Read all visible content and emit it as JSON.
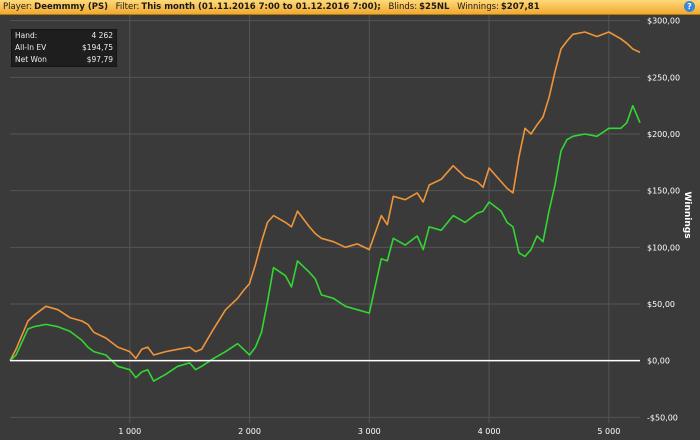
{
  "header": {
    "player_label": "Player:",
    "player_value": "Deemmmy (PS)",
    "filter_label": "Filter:",
    "filter_value": "This month (01.11.2016 7:00 to 01.12.2016 7:00);",
    "blinds_label": "Blinds:",
    "blinds_value": "$25NL",
    "winnings_label": "Winnings:",
    "winnings_value": "$207,81",
    "help_icon": "?"
  },
  "stats": [
    {
      "label": "Hand:",
      "value": "4 262"
    },
    {
      "label": "All-In EV",
      "value": "$194,75"
    },
    {
      "label": "Net Won",
      "value": "$97,79"
    }
  ],
  "chart_data": {
    "type": "line",
    "xlabel": "",
    "ylabel": "Winnings",
    "xlim": [
      0,
      5260
    ],
    "ylim": [
      -55,
      305
    ],
    "x_ticks": [
      1000,
      2000,
      3000,
      4000,
      5000
    ],
    "x_tick_labels": [
      "1 000",
      "2 000",
      "3 000",
      "4 000",
      "5 000"
    ],
    "y_ticks": [
      -50,
      0,
      50,
      100,
      150,
      200,
      250,
      300
    ],
    "y_tick_labels": [
      "-$50,00",
      "$0,00",
      "$50,00",
      "$100,00",
      "$150,00",
      "$200,00",
      "$250,00",
      "$300,00"
    ],
    "grid": true,
    "colors": {
      "all_in_ev": "#f0943a",
      "net_won": "#33d633",
      "zero_line": "#ffffff",
      "background": "#3a3a3a",
      "grid": "#555555"
    },
    "series": [
      {
        "name": "All-In EV",
        "x": [
          0,
          50,
          150,
          200,
          300,
          400,
          500,
          600,
          650,
          700,
          800,
          900,
          1000,
          1050,
          1100,
          1150,
          1200,
          1300,
          1400,
          1500,
          1550,
          1600,
          1700,
          1800,
          1900,
          1950,
          2000,
          2050,
          2100,
          2150,
          2200,
          2300,
          2350,
          2400,
          2500,
          2550,
          2600,
          2700,
          2800,
          2900,
          3000,
          3100,
          3150,
          3200,
          3300,
          3400,
          3450,
          3500,
          3600,
          3700,
          3800,
          3900,
          3950,
          4000,
          4100,
          4150,
          4200,
          4250,
          4300,
          4350,
          4400,
          4450,
          4500,
          4550,
          4600,
          4650,
          4700,
          4800,
          4900,
          5000,
          5100,
          5150,
          5200,
          5260
        ],
        "y": [
          0,
          10,
          35,
          40,
          48,
          45,
          38,
          35,
          32,
          25,
          20,
          12,
          8,
          2,
          10,
          12,
          5,
          8,
          10,
          12,
          8,
          10,
          28,
          45,
          55,
          62,
          68,
          85,
          105,
          122,
          128,
          122,
          118,
          132,
          118,
          112,
          108,
          105,
          100,
          103,
          98,
          128,
          120,
          145,
          142,
          148,
          140,
          155,
          160,
          172,
          162,
          158,
          153,
          170,
          158,
          152,
          148,
          180,
          205,
          200,
          208,
          215,
          232,
          255,
          275,
          282,
          288,
          290,
          286,
          290,
          284,
          280,
          275,
          272
        ]
      },
      {
        "name": "Net Won",
        "x": [
          0,
          50,
          150,
          200,
          300,
          400,
          500,
          600,
          650,
          700,
          800,
          900,
          1000,
          1050,
          1100,
          1150,
          1200,
          1300,
          1400,
          1500,
          1550,
          1600,
          1700,
          1800,
          1900,
          1950,
          2000,
          2050,
          2100,
          2150,
          2200,
          2300,
          2350,
          2400,
          2500,
          2550,
          2600,
          2700,
          2800,
          2900,
          3000,
          3100,
          3150,
          3200,
          3300,
          3400,
          3450,
          3500,
          3600,
          3700,
          3800,
          3900,
          3950,
          4000,
          4100,
          4150,
          4200,
          4250,
          4300,
          4350,
          4400,
          4450,
          4500,
          4550,
          4600,
          4650,
          4700,
          4800,
          4900,
          5000,
          5100,
          5150,
          5200,
          5260
        ],
        "y": [
          0,
          5,
          28,
          30,
          32,
          30,
          26,
          18,
          12,
          8,
          5,
          -5,
          -8,
          -15,
          -10,
          -8,
          -18,
          -12,
          -5,
          -2,
          -8,
          -5,
          2,
          8,
          15,
          10,
          5,
          12,
          25,
          52,
          82,
          75,
          65,
          88,
          78,
          72,
          58,
          55,
          48,
          45,
          42,
          90,
          88,
          108,
          102,
          110,
          98,
          118,
          115,
          128,
          122,
          130,
          132,
          140,
          132,
          122,
          118,
          95,
          92,
          98,
          110,
          105,
          132,
          155,
          185,
          195,
          198,
          200,
          198,
          205,
          205,
          210,
          225,
          210
        ]
      }
    ]
  }
}
